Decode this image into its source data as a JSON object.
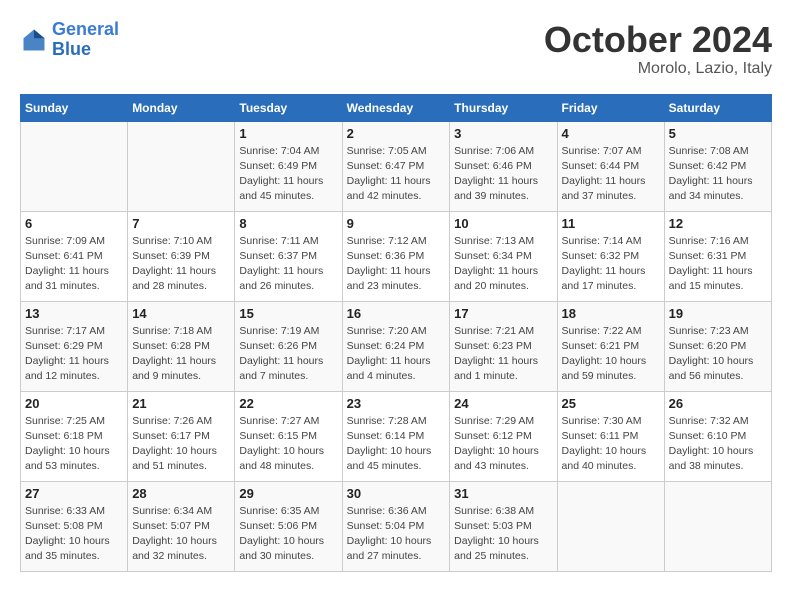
{
  "header": {
    "logo_line1": "General",
    "logo_line2": "Blue",
    "month_title": "October 2024",
    "location": "Morolo, Lazio, Italy"
  },
  "weekdays": [
    "Sunday",
    "Monday",
    "Tuesday",
    "Wednesday",
    "Thursday",
    "Friday",
    "Saturday"
  ],
  "weeks": [
    [
      {
        "day": "",
        "info": ""
      },
      {
        "day": "",
        "info": ""
      },
      {
        "day": "1",
        "info": "Sunrise: 7:04 AM\nSunset: 6:49 PM\nDaylight: 11 hours and 45 minutes."
      },
      {
        "day": "2",
        "info": "Sunrise: 7:05 AM\nSunset: 6:47 PM\nDaylight: 11 hours and 42 minutes."
      },
      {
        "day": "3",
        "info": "Sunrise: 7:06 AM\nSunset: 6:46 PM\nDaylight: 11 hours and 39 minutes."
      },
      {
        "day": "4",
        "info": "Sunrise: 7:07 AM\nSunset: 6:44 PM\nDaylight: 11 hours and 37 minutes."
      },
      {
        "day": "5",
        "info": "Sunrise: 7:08 AM\nSunset: 6:42 PM\nDaylight: 11 hours and 34 minutes."
      }
    ],
    [
      {
        "day": "6",
        "info": "Sunrise: 7:09 AM\nSunset: 6:41 PM\nDaylight: 11 hours and 31 minutes."
      },
      {
        "day": "7",
        "info": "Sunrise: 7:10 AM\nSunset: 6:39 PM\nDaylight: 11 hours and 28 minutes."
      },
      {
        "day": "8",
        "info": "Sunrise: 7:11 AM\nSunset: 6:37 PM\nDaylight: 11 hours and 26 minutes."
      },
      {
        "day": "9",
        "info": "Sunrise: 7:12 AM\nSunset: 6:36 PM\nDaylight: 11 hours and 23 minutes."
      },
      {
        "day": "10",
        "info": "Sunrise: 7:13 AM\nSunset: 6:34 PM\nDaylight: 11 hours and 20 minutes."
      },
      {
        "day": "11",
        "info": "Sunrise: 7:14 AM\nSunset: 6:32 PM\nDaylight: 11 hours and 17 minutes."
      },
      {
        "day": "12",
        "info": "Sunrise: 7:16 AM\nSunset: 6:31 PM\nDaylight: 11 hours and 15 minutes."
      }
    ],
    [
      {
        "day": "13",
        "info": "Sunrise: 7:17 AM\nSunset: 6:29 PM\nDaylight: 11 hours and 12 minutes."
      },
      {
        "day": "14",
        "info": "Sunrise: 7:18 AM\nSunset: 6:28 PM\nDaylight: 11 hours and 9 minutes."
      },
      {
        "day": "15",
        "info": "Sunrise: 7:19 AM\nSunset: 6:26 PM\nDaylight: 11 hours and 7 minutes."
      },
      {
        "day": "16",
        "info": "Sunrise: 7:20 AM\nSunset: 6:24 PM\nDaylight: 11 hours and 4 minutes."
      },
      {
        "day": "17",
        "info": "Sunrise: 7:21 AM\nSunset: 6:23 PM\nDaylight: 11 hours and 1 minute."
      },
      {
        "day": "18",
        "info": "Sunrise: 7:22 AM\nSunset: 6:21 PM\nDaylight: 10 hours and 59 minutes."
      },
      {
        "day": "19",
        "info": "Sunrise: 7:23 AM\nSunset: 6:20 PM\nDaylight: 10 hours and 56 minutes."
      }
    ],
    [
      {
        "day": "20",
        "info": "Sunrise: 7:25 AM\nSunset: 6:18 PM\nDaylight: 10 hours and 53 minutes."
      },
      {
        "day": "21",
        "info": "Sunrise: 7:26 AM\nSunset: 6:17 PM\nDaylight: 10 hours and 51 minutes."
      },
      {
        "day": "22",
        "info": "Sunrise: 7:27 AM\nSunset: 6:15 PM\nDaylight: 10 hours and 48 minutes."
      },
      {
        "day": "23",
        "info": "Sunrise: 7:28 AM\nSunset: 6:14 PM\nDaylight: 10 hours and 45 minutes."
      },
      {
        "day": "24",
        "info": "Sunrise: 7:29 AM\nSunset: 6:12 PM\nDaylight: 10 hours and 43 minutes."
      },
      {
        "day": "25",
        "info": "Sunrise: 7:30 AM\nSunset: 6:11 PM\nDaylight: 10 hours and 40 minutes."
      },
      {
        "day": "26",
        "info": "Sunrise: 7:32 AM\nSunset: 6:10 PM\nDaylight: 10 hours and 38 minutes."
      }
    ],
    [
      {
        "day": "27",
        "info": "Sunrise: 6:33 AM\nSunset: 5:08 PM\nDaylight: 10 hours and 35 minutes."
      },
      {
        "day": "28",
        "info": "Sunrise: 6:34 AM\nSunset: 5:07 PM\nDaylight: 10 hours and 32 minutes."
      },
      {
        "day": "29",
        "info": "Sunrise: 6:35 AM\nSunset: 5:06 PM\nDaylight: 10 hours and 30 minutes."
      },
      {
        "day": "30",
        "info": "Sunrise: 6:36 AM\nSunset: 5:04 PM\nDaylight: 10 hours and 27 minutes."
      },
      {
        "day": "31",
        "info": "Sunrise: 6:38 AM\nSunset: 5:03 PM\nDaylight: 10 hours and 25 minutes."
      },
      {
        "day": "",
        "info": ""
      },
      {
        "day": "",
        "info": ""
      }
    ]
  ]
}
